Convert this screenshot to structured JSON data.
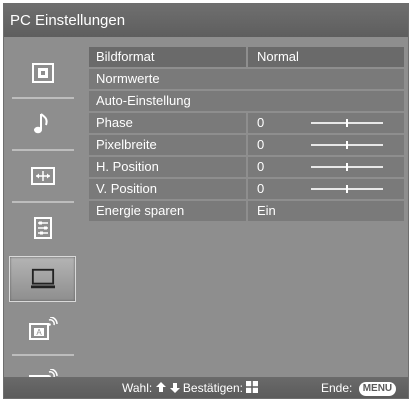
{
  "window": {
    "title": "PC Einstellungen"
  },
  "sidebar": {
    "items": [
      {
        "icon": "picture-icon"
      },
      {
        "icon": "sound-note-icon"
      },
      {
        "icon": "screen-format-icon"
      },
      {
        "icon": "settings-list-icon"
      },
      {
        "icon": "pc-monitor-icon",
        "selected": true
      },
      {
        "icon": "analog-input-icon",
        "glyph": "A"
      },
      {
        "icon": "digital-input-icon",
        "glyph": "D"
      }
    ]
  },
  "menu": {
    "rows": [
      {
        "label": "Bildformat",
        "value": "Normal"
      },
      {
        "label": "Normwerte"
      },
      {
        "label": "Auto-Einstellung"
      },
      {
        "label": "Phase",
        "value": "0",
        "slider_level": 0.5
      },
      {
        "label": "Pixelbreite",
        "value": "0",
        "slider_level": 0.5
      },
      {
        "label": "H. Position",
        "value": "0",
        "slider_level": 0.5
      },
      {
        "label": "V. Position",
        "value": "0",
        "slider_level": 0.5
      },
      {
        "label": "Energie sparen",
        "value": "Ein"
      }
    ]
  },
  "footer": {
    "select_label": "Wahl:",
    "confirm_label": "Bestätigen:",
    "end_label": "Ende:",
    "menu_key": "MENU"
  },
  "colors": {
    "background": "#8e8e8e",
    "row": "#7a7a7a",
    "bars": "#5e5e5e",
    "text": "#ffffff"
  }
}
